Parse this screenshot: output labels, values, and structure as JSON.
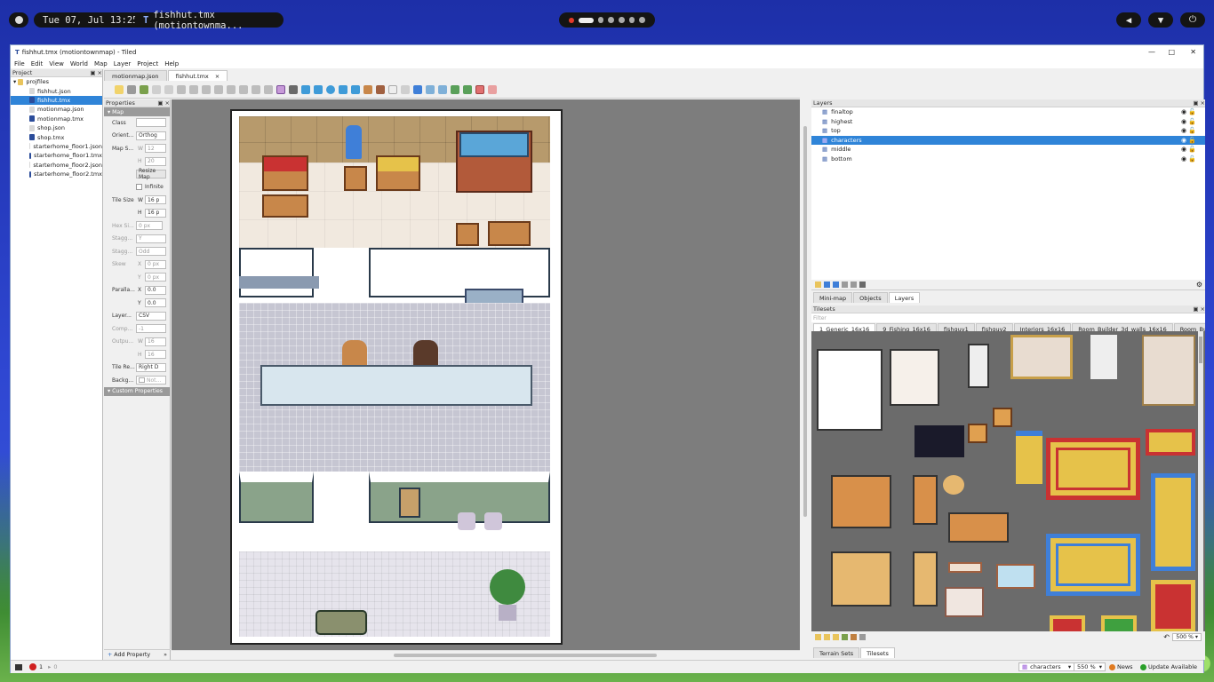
{
  "desktop": {
    "datetime": "Tue 07, Jul 13:25",
    "task_label": "fishhut.tmx (motiontownma...",
    "task_icon_text": "T"
  },
  "window": {
    "title": "fishhut.tmx (motiontownmap) - Tiled",
    "controls": [
      "—",
      "□",
      "✕"
    ]
  },
  "menu": [
    "File",
    "Edit",
    "View",
    "World",
    "Map",
    "Layer",
    "Project",
    "Help"
  ],
  "project": {
    "header": "Project",
    "root": "projfiles",
    "files": [
      {
        "name": "fishhut.json",
        "kind": "json"
      },
      {
        "name": "fishhut.tmx",
        "kind": "tmx",
        "selected": true
      },
      {
        "name": "motionmap.json",
        "kind": "json"
      },
      {
        "name": "motionmap.tmx",
        "kind": "tmx"
      },
      {
        "name": "shop.json",
        "kind": "json"
      },
      {
        "name": "shop.tmx",
        "kind": "tmx"
      },
      {
        "name": "starterhome_floor1.json",
        "kind": "json"
      },
      {
        "name": "starterhome_floor1.tmx",
        "kind": "tmx"
      },
      {
        "name": "starterhome_floor2.json",
        "kind": "json"
      },
      {
        "name": "starterhome_floor2.tmx",
        "kind": "tmx"
      }
    ]
  },
  "editor_tabs": [
    {
      "label": "motionmap.json",
      "active": false
    },
    {
      "label": "fishhut.tmx",
      "active": true
    }
  ],
  "properties": {
    "header": "Properties",
    "group_map": "Map",
    "class_label": "Class",
    "orientation_label": "Orient...",
    "orientation_value": "Orthog",
    "map_size_label": "Map S...",
    "map_w": "12",
    "map_h": "20",
    "resize_button": "Resize Map",
    "infinite_label": "Infinite",
    "tile_size_label": "Tile Size",
    "tile_w": "16 p",
    "tile_h": "16 p",
    "hex_label": "Hex Si...",
    "hex_value": "0 px",
    "stagger_axis_label": "Stagg...",
    "stagger_axis_value": "Y",
    "stagger_index_label": "Stagg...",
    "stagger_index_value": "Odd",
    "skew_label": "Skew",
    "skew_x": "0 px",
    "skew_y": "0 px",
    "parallax_label": "Paralla...",
    "parallax_x": "0.0",
    "parallax_y": "0.0",
    "layer_format_label": "Layer...",
    "layer_format_value": "CSV",
    "compression_label": "Comp...",
    "compression_value": "-1",
    "output_label": "Outpu...",
    "output_w": "16",
    "output_h": "16",
    "render_order_label": "Tile Re...",
    "render_order_value": "Right D",
    "background_label": "Backg...",
    "background_value": "Not...",
    "group_custom": "Custom Properties",
    "add_property": "Add Property",
    "axis_x": "X",
    "axis_y": "Y",
    "axis_w": "W",
    "axis_h": "H"
  },
  "layers": {
    "header": "Layers",
    "items": [
      {
        "name": "finaltop",
        "selected": false
      },
      {
        "name": "highest",
        "selected": false
      },
      {
        "name": "top",
        "selected": false
      },
      {
        "name": "characters",
        "selected": true
      },
      {
        "name": "middle",
        "selected": false
      },
      {
        "name": "bottom",
        "selected": false
      }
    ],
    "tabs": [
      "Mini-map",
      "Objects",
      "Layers"
    ],
    "active_tab": "Layers"
  },
  "tilesets": {
    "header": "Tilesets",
    "filter_placeholder": "Filter",
    "tabs": [
      "1_Generic_16x16",
      "9_Fishing_16x16",
      "fishguy1",
      "fishguy2",
      "Interiors_16x16",
      "Room_Builder_3d_walls_16x16",
      "Room_Builder_borde"
    ],
    "zoom": "500 %",
    "bottom_tabs": [
      "Terrain Sets",
      "Tilesets"
    ],
    "active_bottom_tab": "Tilesets"
  },
  "status": {
    "errors": "1",
    "warnings": "0",
    "current_layer": "characters",
    "zoom": "550 %",
    "news": "News",
    "update": "Update Available"
  },
  "colors": {
    "accent": "#2f84d8",
    "canvas_bg": "#7d7d7d",
    "tileset_bg": "#6b6b6b",
    "wood": "#c8874a",
    "counter_green": "#8aa38a"
  }
}
